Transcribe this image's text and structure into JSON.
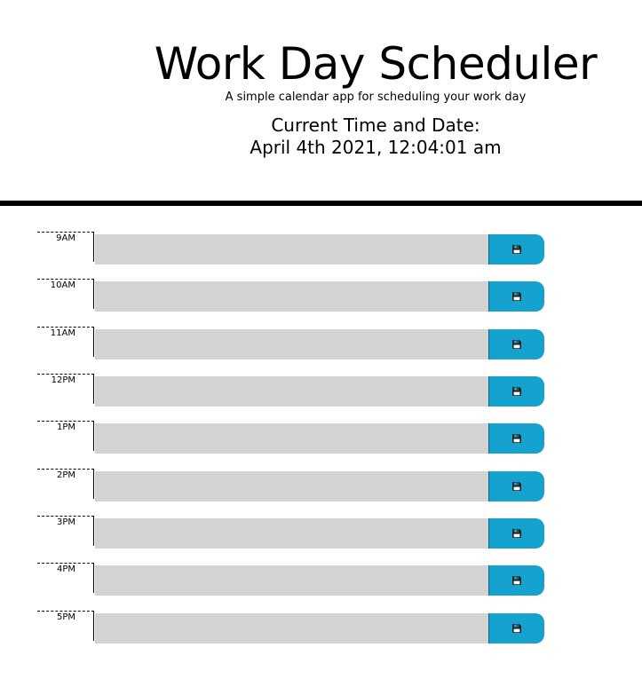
{
  "header": {
    "title": "Work Day Scheduler",
    "subtitle": "A simple calendar app for scheduling your work day",
    "time_label": "Current Time and Date:",
    "time_value": "April 4th 2021, 12:04:01 am"
  },
  "colors": {
    "textarea_bg": "#d3d3d3",
    "save_button": "#15a2cf",
    "divider": "#000000"
  },
  "rows": [
    {
      "hour": "9AM",
      "text": ""
    },
    {
      "hour": "10AM",
      "text": ""
    },
    {
      "hour": "11AM",
      "text": ""
    },
    {
      "hour": "12PM",
      "text": ""
    },
    {
      "hour": "1PM",
      "text": ""
    },
    {
      "hour": "2PM",
      "text": ""
    },
    {
      "hour": "3PM",
      "text": ""
    },
    {
      "hour": "4PM",
      "text": ""
    },
    {
      "hour": "5PM",
      "text": ""
    }
  ],
  "save_icon": "floppy-disk-icon"
}
